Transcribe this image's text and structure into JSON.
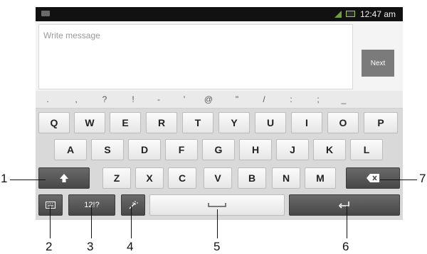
{
  "status_bar": {
    "time": "12:47 am"
  },
  "composer": {
    "placeholder": "Write message",
    "next_label": "Next"
  },
  "symbol_row": [
    ".",
    ",",
    "?",
    "!",
    "-",
    "'",
    "@",
    "\"",
    "/",
    ":",
    ";",
    "_"
  ],
  "rows": [
    [
      "Q",
      "W",
      "E",
      "R",
      "T",
      "Y",
      "U",
      "I",
      "O",
      "P"
    ],
    [
      "A",
      "S",
      "D",
      "F",
      "G",
      "H",
      "J",
      "K",
      "L"
    ],
    [
      "Z",
      "X",
      "C",
      "V",
      "B",
      "N",
      "M"
    ]
  ],
  "keys": {
    "numbers_label": "12!?"
  },
  "callouts": [
    "1",
    "2",
    "3",
    "4",
    "5",
    "6",
    "7"
  ]
}
